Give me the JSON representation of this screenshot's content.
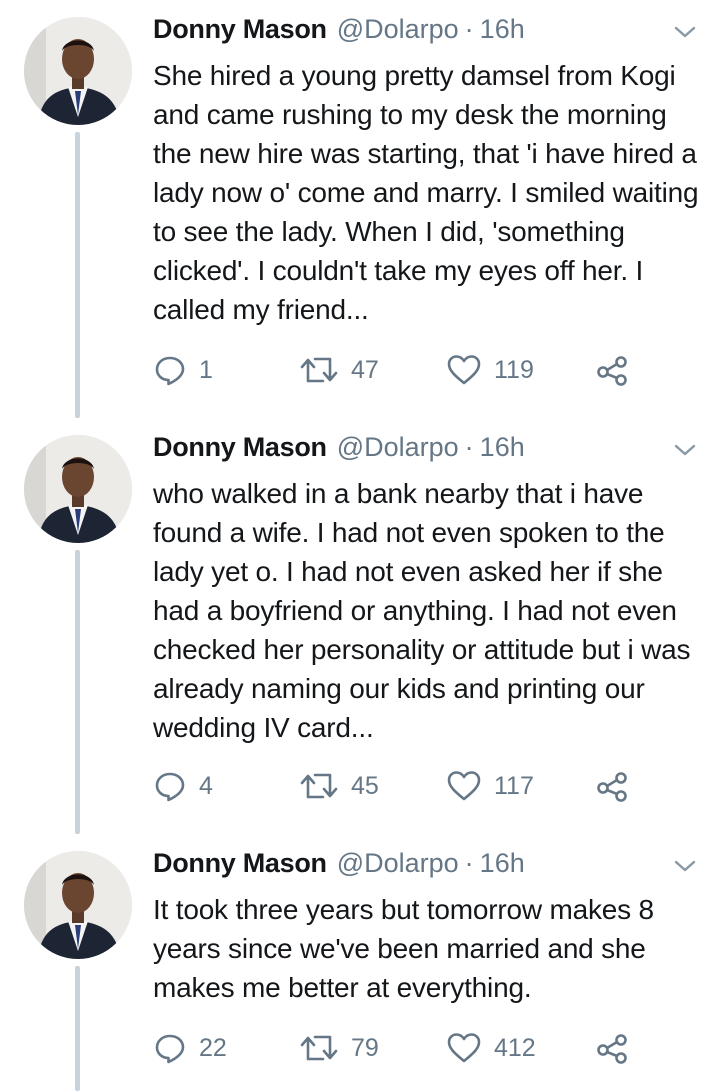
{
  "tweets": [
    {
      "author_name": "Donny Mason",
      "handle": "@Dolarpo",
      "separator": "·",
      "time": "16h",
      "text": "She hired a young pretty damsel from Kogi and came rushing to my desk the morning the new hire was starting, that 'i have hired a lady now o' come and marry. I smiled waiting to see the lady. When I did, 'something clicked'. I couldn't take my eyes off her. I called my friend...",
      "replies": "1",
      "retweets": "47",
      "likes": "119"
    },
    {
      "author_name": "Donny Mason",
      "handle": "@Dolarpo",
      "separator": "·",
      "time": "16h",
      "text": "who walked in a bank nearby that i have found a wife. I had not even spoken to the lady yet o. I had not even asked her if she had a boyfriend or anything. I had not even checked her personality or attitude but i was already naming our kids and printing our wedding IV card...",
      "replies": "4",
      "retweets": "45",
      "likes": "117"
    },
    {
      "author_name": "Donny Mason",
      "handle": "@Dolarpo",
      "separator": "·",
      "time": "16h",
      "text": "It took three years but tomorrow makes 8 years since we've been married and she makes me better at everything.",
      "replies": "22",
      "retweets": "79",
      "likes": "412"
    }
  ],
  "icons": {
    "reply": "reply-icon",
    "retweet": "retweet-icon",
    "like": "heart-icon",
    "share": "share-icon",
    "menu": "chevron-down-icon"
  },
  "colors": {
    "text": "#14171a",
    "secondary": "#657786",
    "thread_line": "#c9d3dc"
  }
}
